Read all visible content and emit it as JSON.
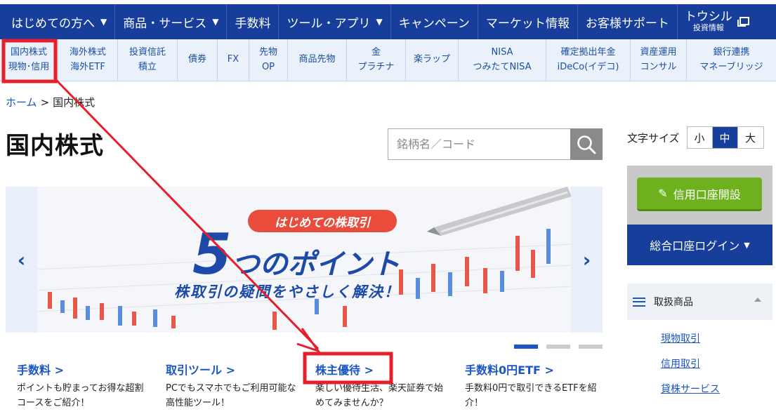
{
  "topnav": {
    "items": [
      {
        "label": "はじめての方へ",
        "caret": "▼"
      },
      {
        "label": "商品・サービス",
        "caret": "▼"
      },
      {
        "label": "手数料",
        "caret": ""
      },
      {
        "label": "ツール・アプリ",
        "caret": "▼"
      },
      {
        "label": "キャンペーン",
        "caret": ""
      },
      {
        "label": "マーケット情報",
        "caret": ""
      },
      {
        "label": "お客様サポート",
        "caret": ""
      }
    ],
    "toshiru_big": "トウシル",
    "toshiru_small": "投資情報"
  },
  "subnav": {
    "items": [
      {
        "line1": "国内株式",
        "line2": "現物･信用"
      },
      {
        "line1": "海外株式",
        "line2": "海外ETF"
      },
      {
        "line1": "投資信託",
        "line2": "積立"
      },
      {
        "line1": "債券",
        "line2": ""
      },
      {
        "line1": "FX",
        "line2": ""
      },
      {
        "line1": "先物",
        "line2": "OP"
      },
      {
        "line1": "商品先物",
        "line2": ""
      },
      {
        "line1": "金",
        "line2": "プラチナ"
      },
      {
        "line1": "楽ラップ",
        "line2": ""
      },
      {
        "line1": "NISA",
        "line2": "つみたてNISA"
      },
      {
        "line1": "確定拠出年金",
        "line2": "iDeCo(イデコ)"
      },
      {
        "line1": "資産運用",
        "line2": "コンサル"
      },
      {
        "line1": "銀行連携",
        "line2": "マネーブリッジ"
      }
    ]
  },
  "breadcrumb": {
    "home": "ホーム",
    "sep": ">",
    "current": "国内株式"
  },
  "page_title": "国内株式",
  "search": {
    "placeholder": "銘柄名／コード"
  },
  "banner": {
    "pill": "はじめての株取引",
    "headline_num": "5",
    "headline_rest": "つのポイント",
    "subline": "株取引の疑問をやさしく解決！",
    "prev": "‹",
    "next": "›"
  },
  "carousel": {
    "current": 1,
    "total": 3
  },
  "features": [
    {
      "title": "手数料 >",
      "desc": "ポイントも貯まってお得な超割コースをご紹介！"
    },
    {
      "title": "取引ツール >",
      "desc": "PCでもスマホでもご利用可能な高性能ツール！"
    },
    {
      "title": "株主優待 >",
      "desc": "楽しい優待生活、楽天証券で始めてみませんか？"
    },
    {
      "title": "手数料0円ETF >",
      "desc": "手数料0円で取引できるETFを紹介！"
    }
  ],
  "fontsize": {
    "label": "文字サイズ",
    "options": [
      "小",
      "中",
      "大"
    ],
    "selected": "中"
  },
  "sidebar": {
    "open_account": "信用口座開設",
    "login": "総合口座ログイン",
    "login_caret": "▼",
    "products_title": "取扱商品",
    "product_links": [
      "現物取引",
      "信用取引",
      "貸株サービス"
    ]
  },
  "colors": {
    "nav": "#173e9b",
    "accent_green": "#6db21e",
    "link": "#1a56c4",
    "annotation_red": "#e5202b"
  }
}
